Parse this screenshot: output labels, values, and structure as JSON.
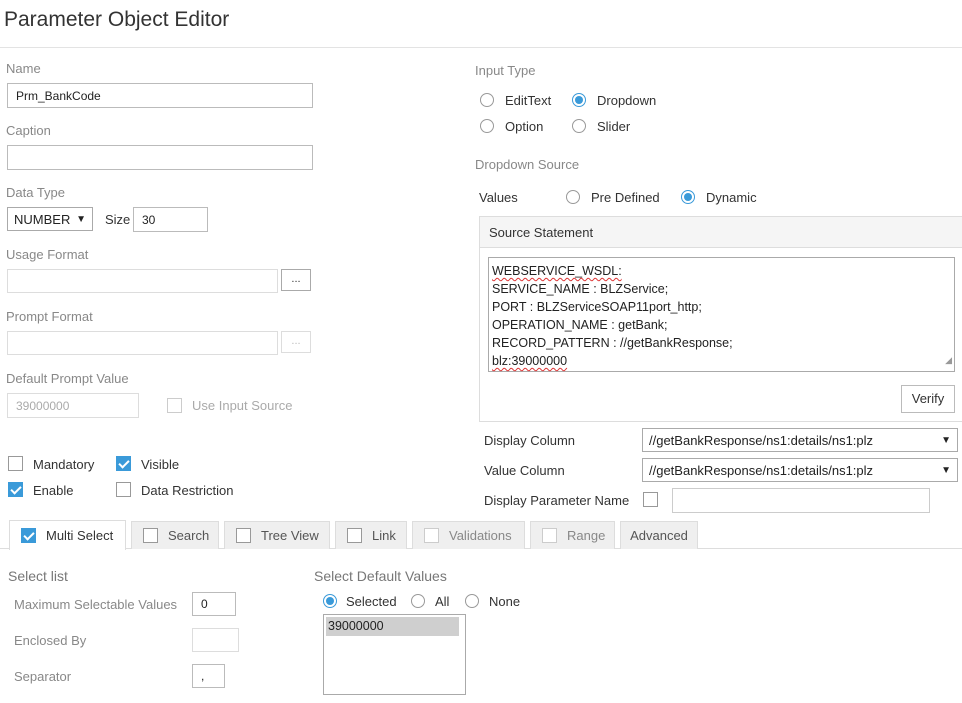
{
  "title": "Parameter Object Editor",
  "name": {
    "label": "Name",
    "value": "Prm_BankCode"
  },
  "caption": {
    "label": "Caption",
    "value": ""
  },
  "data_type": {
    "label": "Data Type",
    "value": "NUMBER",
    "size_label": "Size",
    "size_value": "30"
  },
  "usage_format": {
    "label": "Usage Format",
    "value": "",
    "button": "..."
  },
  "prompt_format": {
    "label": "Prompt Format",
    "value": "",
    "button": "..."
  },
  "default_prompt": {
    "label": "Default Prompt Value",
    "value": "39000000",
    "use_input_source": "Use Input Source",
    "use_input_source_checked": false
  },
  "flags": {
    "mandatory": {
      "label": "Mandatory",
      "checked": false
    },
    "visible": {
      "label": "Visible",
      "checked": true
    },
    "enable": {
      "label": "Enable",
      "checked": true
    },
    "data_restriction": {
      "label": "Data Restriction",
      "checked": false
    }
  },
  "input_type": {
    "label": "Input Type",
    "options": [
      "EditText",
      "Dropdown",
      "Option",
      "Slider"
    ],
    "selected": "Dropdown"
  },
  "dropdown_source": {
    "label": "Dropdown Source",
    "values_label": "Values",
    "options": [
      "Pre Defined",
      "Dynamic"
    ],
    "selected": "Dynamic",
    "source_statement_label": "Source Statement",
    "statement_lines": [
      "WEBSERVICE_WSDL:",
      "SERVICE_NAME : BLZService;",
      "PORT : BLZServiceSOAP11port_http;",
      "OPERATION_NAME : getBank;",
      "RECORD_PATTERN : //getBankResponse;",
      "blz:39000000"
    ],
    "verify": "Verify",
    "display_column_label": "Display Column",
    "display_column_value": "//getBankResponse/ns1:details/ns1:plz",
    "value_column_label": "Value Column",
    "value_column_value": "//getBankResponse/ns1:details/ns1:plz",
    "display_param_label": "Display Parameter Name",
    "display_param_value": ""
  },
  "tabs": [
    {
      "label": "Multi Select",
      "checked": true
    },
    {
      "label": "Search",
      "checked": false
    },
    {
      "label": "Tree View",
      "checked": false
    },
    {
      "label": "Link",
      "checked": false
    },
    {
      "label": "Validations",
      "checked": false
    },
    {
      "label": "Range",
      "checked": false
    },
    {
      "label": "Advanced"
    }
  ],
  "select_list": {
    "heading": "Select list",
    "max_label": "Maximum Selectable Values",
    "max_value": "0",
    "enclosed_label": "Enclosed By",
    "enclosed_value": "",
    "separator_label": "Separator",
    "separator_value": ","
  },
  "select_default": {
    "heading": "Select Default Values",
    "options": [
      "Selected",
      "All",
      "None"
    ],
    "selected": "Selected",
    "items": [
      "39000000"
    ]
  },
  "colors": {
    "accent": "#3a9ad9",
    "label": "#888888",
    "border": "#bbbbbb"
  },
  "icons": {
    "dropdown": "triangle-down-icon",
    "check": "check-icon"
  }
}
